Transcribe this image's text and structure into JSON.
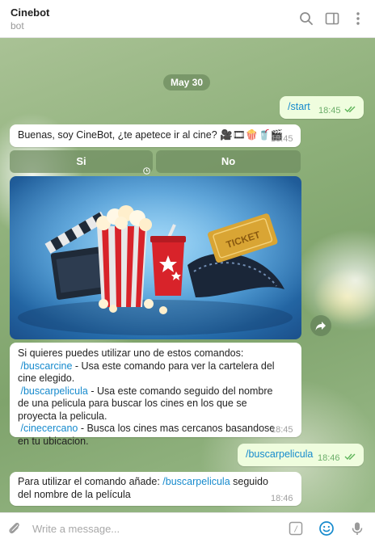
{
  "header": {
    "title": "Cinebot",
    "subtitle": "bot",
    "icons": [
      "search-icon",
      "sidebar-toggle-icon",
      "more-vertical-icon"
    ]
  },
  "chat": {
    "date": "May 30",
    "messages": [
      {
        "id": "m1",
        "direction": "out",
        "text": "/start",
        "time": "18:45",
        "read": true
      },
      {
        "id": "m2",
        "direction": "in",
        "text": "Buenas, soy CineBot, ¿te apetece ir al cine? 🎥🎞🍿🥤🎬",
        "time": "18:45"
      },
      {
        "id": "m5",
        "direction": "in",
        "type": "photo",
        "subject": "popcorn, soda cup, clapperboard and movie ticket",
        "action_icon": "share-icon"
      },
      {
        "id": "m6",
        "direction": "in",
        "time": "18:45",
        "intro": "Si quieres puedes utilizar uno de estos comandos:",
        "commands": [
          {
            "cmd": "/buscarcine",
            "desc": " - Usa este comando para ver la cartelera del cine elegido."
          },
          {
            "cmd": "/buscarpelicula",
            "desc": " - Usa este comando seguido del nombre de una pelicula para buscar los cines en los que se proyecta la pelicula."
          },
          {
            "cmd": "/cinecercano",
            "desc": " - Busca los cines mas cercanos basandose en tu ubicacion."
          }
        ]
      },
      {
        "id": "m7",
        "direction": "out",
        "text": "/buscarpelicula",
        "time": "18:46",
        "read": true
      },
      {
        "id": "m8",
        "direction": "in",
        "time": "18:46",
        "prefix": "Para utilizar el comando añade: ",
        "cmd": "/buscarpelicula",
        "suffix": " seguido del nombre de la película"
      }
    ],
    "keyboard": [
      "Si",
      "No"
    ]
  },
  "composer": {
    "placeholder": "Write a message...",
    "icons": [
      "attach-icon",
      "bot-commands-icon",
      "emoji-icon",
      "microphone-icon"
    ],
    "commands_glyph": "/"
  },
  "colors": {
    "accent": "#168acd",
    "outgoing_bubble": "#effdde",
    "read_check": "#5fb55a"
  }
}
